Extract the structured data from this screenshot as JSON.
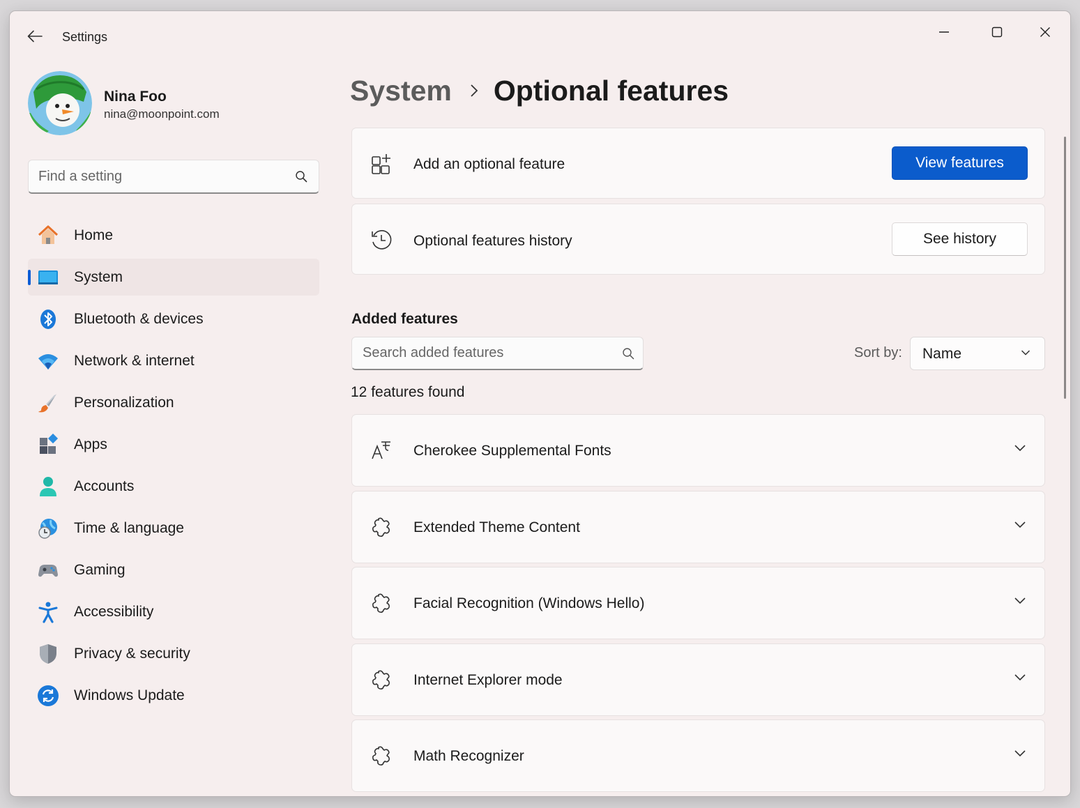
{
  "window": {
    "title": "Settings"
  },
  "profile": {
    "name": "Nina Foo",
    "email": "nina@moonpoint.com"
  },
  "search": {
    "placeholder": "Find a setting"
  },
  "nav": {
    "items": [
      {
        "id": "home",
        "label": "Home",
        "icon": "home-icon"
      },
      {
        "id": "system",
        "label": "System",
        "icon": "system-icon",
        "active": true
      },
      {
        "id": "bluetooth",
        "label": "Bluetooth & devices",
        "icon": "bluetooth-icon"
      },
      {
        "id": "network",
        "label": "Network & internet",
        "icon": "wifi-icon"
      },
      {
        "id": "personalization",
        "label": "Personalization",
        "icon": "brush-icon"
      },
      {
        "id": "apps",
        "label": "Apps",
        "icon": "apps-icon"
      },
      {
        "id": "accounts",
        "label": "Accounts",
        "icon": "person-icon"
      },
      {
        "id": "time",
        "label": "Time & language",
        "icon": "globe-clock-icon"
      },
      {
        "id": "gaming",
        "label": "Gaming",
        "icon": "gamepad-icon"
      },
      {
        "id": "accessibility",
        "label": "Accessibility",
        "icon": "accessibility-icon"
      },
      {
        "id": "privacy",
        "label": "Privacy & security",
        "icon": "shield-icon"
      },
      {
        "id": "update",
        "label": "Windows Update",
        "icon": "sync-icon"
      }
    ]
  },
  "breadcrumb": {
    "parent": "System",
    "current": "Optional features"
  },
  "add_feature": {
    "label": "Add an optional feature",
    "button": "View features"
  },
  "history": {
    "label": "Optional features history",
    "button": "See history"
  },
  "added": {
    "title": "Added features",
    "search_placeholder": "Search added features",
    "sort_label": "Sort by:",
    "sort_value": "Name",
    "count_text": "12 features found",
    "features": [
      {
        "label": "Cherokee Supplemental Fonts",
        "icon": "font-icon"
      },
      {
        "label": "Extended Theme Content",
        "icon": "puzzle-icon"
      },
      {
        "label": "Facial Recognition (Windows Hello)",
        "icon": "puzzle-icon"
      },
      {
        "label": "Internet Explorer mode",
        "icon": "puzzle-icon"
      },
      {
        "label": "Math Recognizer",
        "icon": "puzzle-icon"
      }
    ]
  },
  "colors": {
    "accent": "#0b5ccc",
    "background": "#f6eeee",
    "card": "#fbf9f9"
  }
}
